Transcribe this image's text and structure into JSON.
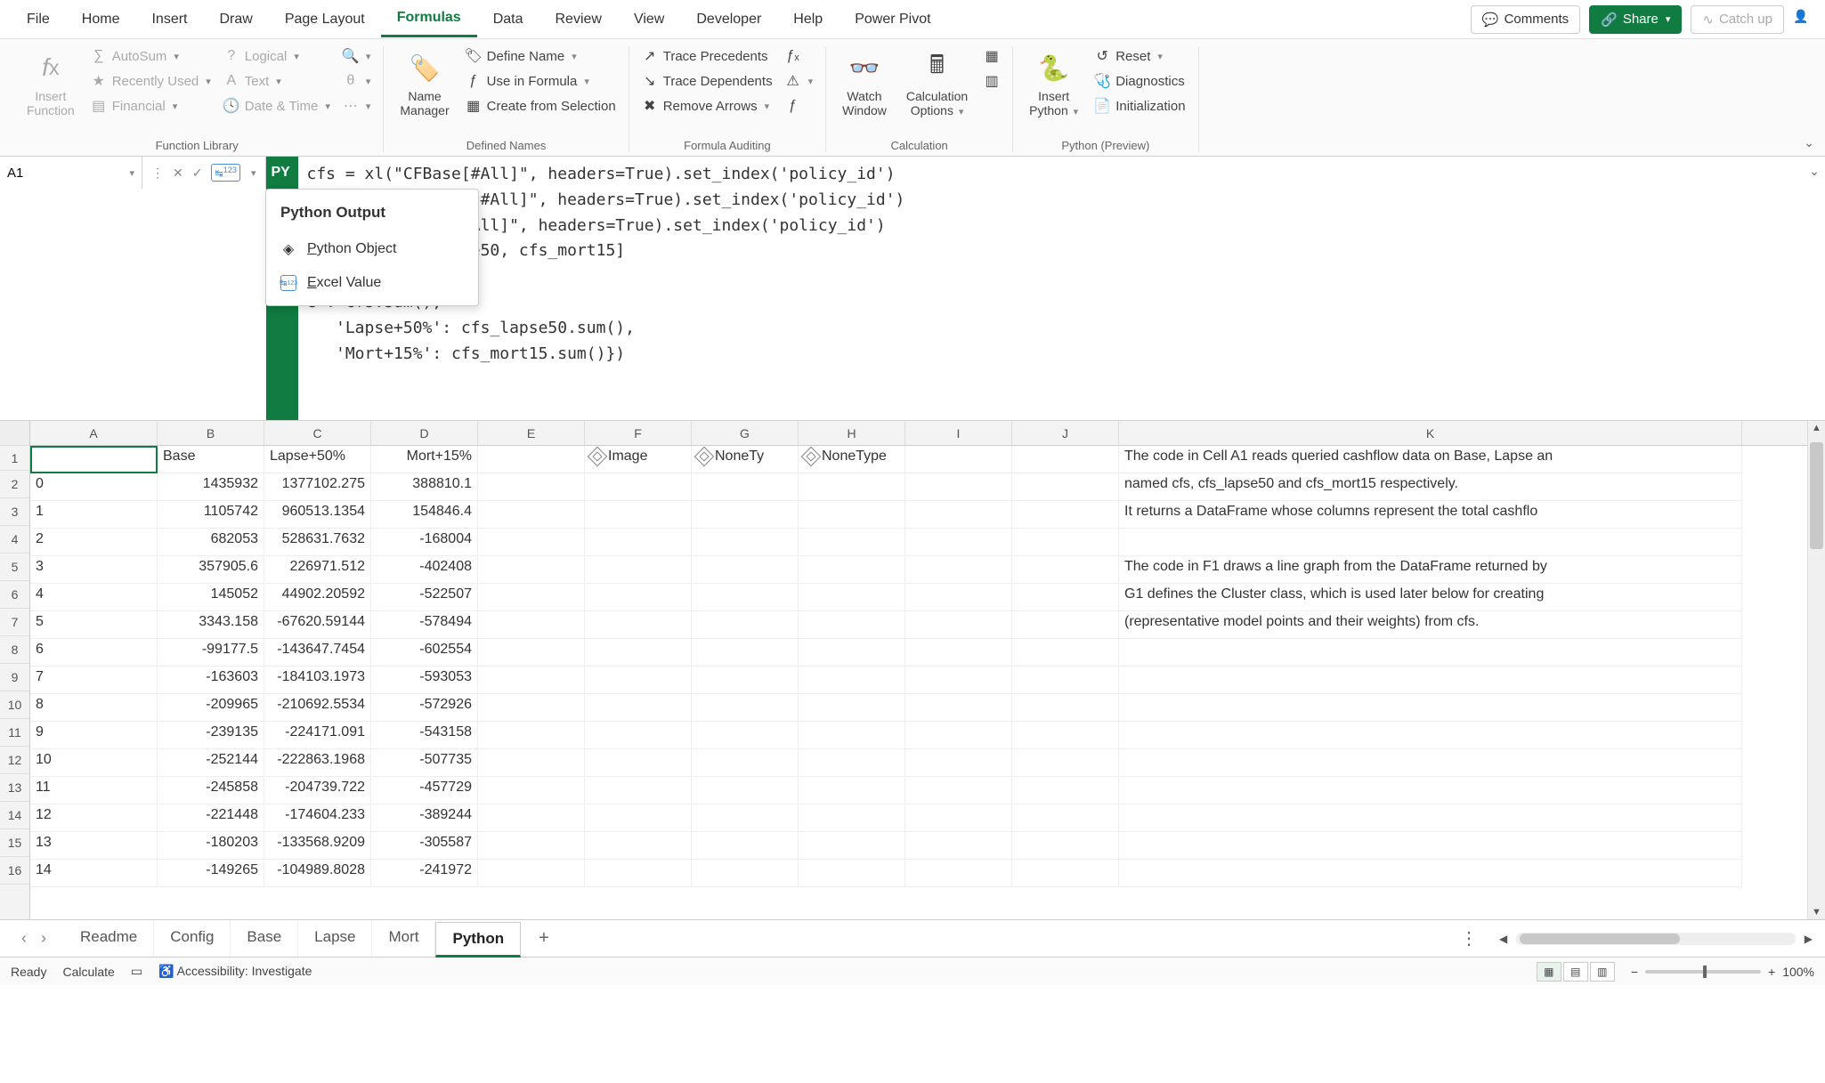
{
  "ribbon": {
    "tabs": [
      "File",
      "Home",
      "Insert",
      "Draw",
      "Page Layout",
      "Formulas",
      "Data",
      "Review",
      "View",
      "Developer",
      "Help",
      "Power Pivot"
    ],
    "active": "Formulas",
    "comments": "Comments",
    "share": "Share",
    "catchup": "Catch up"
  },
  "groups": {
    "function_library": {
      "insert_function": "Insert\nFunction",
      "autosum": "AutoSum",
      "recently_used": "Recently Used",
      "financial": "Financial",
      "logical": "Logical",
      "text": "Text",
      "date_time": "Date & Time",
      "label": "Function Library"
    },
    "defined_names": {
      "name_manager": "Name\nManager",
      "define_name": "Define Name",
      "use_in_formula": "Use in Formula",
      "create_from_selection": "Create from Selection",
      "label": "Defined Names"
    },
    "formula_auditing": {
      "trace_precedents": "Trace Precedents",
      "trace_dependents": "Trace Dependents",
      "remove_arrows": "Remove Arrows",
      "label": "Formula Auditing"
    },
    "calculation": {
      "watch_window": "Watch\nWindow",
      "calc_options": "Calculation\nOptions",
      "label": "Calculation"
    },
    "python": {
      "insert_python": "Insert\nPython",
      "reset": "Reset",
      "diagnostics": "Diagnostics",
      "initialization": "Initialization",
      "label": "Python (Preview)"
    }
  },
  "name_box": "A1",
  "py_badge": "PY",
  "formula": "cfs = xl(\"CFBase[#All]\", headers=True).set_index('policy_id')\ne50 = xl(\"CFLapse[#All]\", headers=True).set_index('policy_id')\n15 = xl(\"CFMort[#All]\", headers=True).set_index('policy_id')\n = [cfs, cfs_lapse50, cfs_mort15]\nrame.from_dict({\ne': cfs.sum(),\n   'Lapse+50%': cfs_lapse50.sum(),\n   'Mort+15%': cfs_mort15.sum()})",
  "py_menu": {
    "title": "Python Output",
    "opt1": "Python Object",
    "opt2": "Excel Value",
    "u1": "P",
    "u2": "E"
  },
  "columns": [
    "A",
    "B",
    "C",
    "D",
    "E",
    "F",
    "G",
    "H",
    "I",
    "J",
    "K"
  ],
  "row_nums": [
    "1",
    "2",
    "3",
    "4",
    "5",
    "6",
    "7",
    "8",
    "9",
    "10",
    "11",
    "12",
    "13",
    "14",
    "15",
    "16"
  ],
  "headers": {
    "B": "Base",
    "C": "Lapse+50%",
    "D": "Mort+15%"
  },
  "f1": "Image",
  "g1": "NoneTy",
  "h1": "NoneType",
  "k_text": {
    "1": "The code in Cell A1 reads queried cashflow data on Base, Lapse an",
    "2": "named cfs, cfs_lapse50 and cfs_mort15 respectively.",
    "3": "It returns a DataFrame whose columns represent the total cashflo",
    "5": "The code in F1 draws a line graph from the DataFrame returned by",
    "6": "G1 defines the Cluster class, which is used later below for creating",
    "7": "(representative model points and their weights) from cfs."
  },
  "data_rows": [
    {
      "A": "0",
      "B": "1435932",
      "C": "1377102.275",
      "D": "388810.1"
    },
    {
      "A": "1",
      "B": "1105742",
      "C": "960513.1354",
      "D": "154846.4"
    },
    {
      "A": "2",
      "B": "682053",
      "C": "528631.7632",
      "D": "-168004"
    },
    {
      "A": "3",
      "B": "357905.6",
      "C": "226971.512",
      "D": "-402408"
    },
    {
      "A": "4",
      "B": "145052",
      "C": "44902.20592",
      "D": "-522507"
    },
    {
      "A": "5",
      "B": "3343.158",
      "C": "-67620.59144",
      "D": "-578494"
    },
    {
      "A": "6",
      "B": "-99177.5",
      "C": "-143647.7454",
      "D": "-602554"
    },
    {
      "A": "7",
      "B": "-163603",
      "C": "-184103.1973",
      "D": "-593053"
    },
    {
      "A": "8",
      "B": "-209965",
      "C": "-210692.5534",
      "D": "-572926"
    },
    {
      "A": "9",
      "B": "-239135",
      "C": "-224171.091",
      "D": "-543158"
    },
    {
      "A": "10",
      "B": "-252144",
      "C": "-222863.1968",
      "D": "-507735"
    },
    {
      "A": "11",
      "B": "-245858",
      "C": "-204739.722",
      "D": "-457729"
    },
    {
      "A": "12",
      "B": "-221448",
      "C": "-174604.233",
      "D": "-389244"
    },
    {
      "A": "13",
      "B": "-180203",
      "C": "-133568.9209",
      "D": "-305587"
    },
    {
      "A": "14",
      "B": "-149265",
      "C": "-104989.8028",
      "D": "-241972"
    }
  ],
  "sheets": [
    "Readme",
    "Config",
    "Base",
    "Lapse",
    "Mort",
    "Python"
  ],
  "active_sheet": "Python",
  "status": {
    "ready": "Ready",
    "calculate": "Calculate",
    "accessibility": "Accessibility: Investigate",
    "zoom": "100%"
  }
}
